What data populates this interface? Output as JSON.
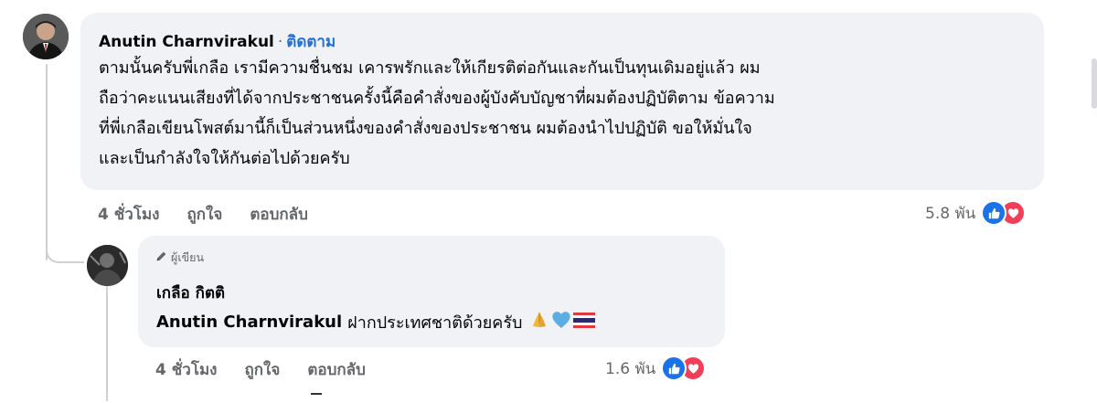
{
  "main_comment": {
    "author": "Anutin Charnvirakul",
    "separator": "·",
    "follow_label": "ติดตาม",
    "text": "ตามนั้นครับพี่เกลือ เรามีความชื่นชม เคารพรักและให้เกียรติต่อกันและกันเป็นทุนเดิมอยู่แล้ว ผม\nถือว่าคะแนนเสียงที่ได้จากประชาชนครั้งนี้คือคำสั่งของผู้บังคับบัญชาที่ผมต้องปฏิบัติตาม ข้อความ\nที่พี่เกลือเขียนโพสต์มานี้ก็เป็นส่วนหนึ่งของคำสั่งของประชาชน ผมต้องนำไปปฏิบัติ ขอให้มั่นใจ\nและเป็นกำลังใจให้กันต่อไปด้วยครับ",
    "time": "4 ชั่วโมง",
    "like_label": "ถูกใจ",
    "reply_label": "ตอบกลับ",
    "reaction_count": "5.8 พัน"
  },
  "reply_comment": {
    "badge": "ผู้เขียน",
    "author": "เกลือ กิตติ",
    "tagged_name": "Anutin Charnvirakul",
    "text": "ฝากประเทศชาติด้วยครับ",
    "time": "4 ชั่วโมง",
    "like_label": "ถูกใจ",
    "reply_label": "ตอบกลับ",
    "reaction_count": "1.6 พัน"
  },
  "icons": {
    "badge": "pencil-icon",
    "reactions": [
      "like-icon",
      "love-icon"
    ],
    "emojis": [
      "folded-hands-icon",
      "blue-heart-icon",
      "thai-flag-icon"
    ]
  },
  "colors": {
    "bubble": "#f0f2f5",
    "follow": "#216fdb",
    "secondary_text": "#65676b",
    "like": "#1a73e8",
    "love": "#f33e58"
  }
}
